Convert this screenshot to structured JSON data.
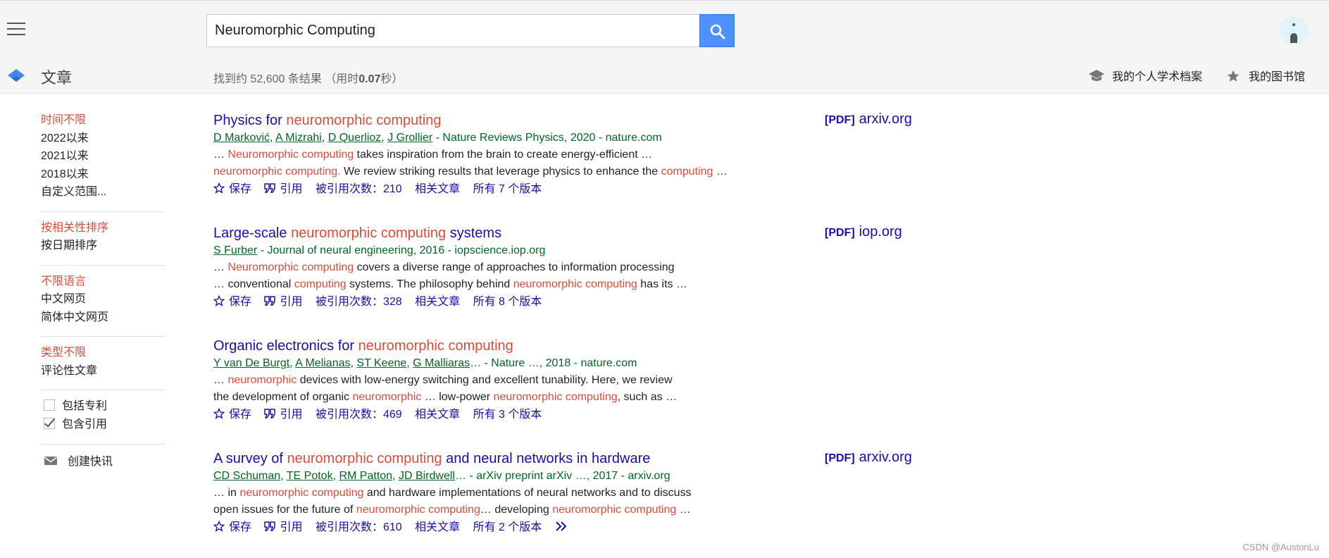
{
  "search": {
    "query": "Neuromorphic Computing"
  },
  "subbar": {
    "section_title": "文章",
    "stats_prefix": "找到约 52,600 条结果 （用时",
    "stats_time": "0.07",
    "stats_suffix": "秒）",
    "profile_label": "我的个人学术档案",
    "library_label": "我的图书馆"
  },
  "sidebar": {
    "time": [
      "时间不限",
      "2022以来",
      "2021以来",
      "2018以来",
      "自定义范围..."
    ],
    "sort": [
      "按相关性排序",
      "按日期排序"
    ],
    "language": [
      "不限语言",
      "中文网页",
      "简体中文网页"
    ],
    "type": [
      "类型不限",
      "评论性文章"
    ],
    "include_patents": "包括专利",
    "include_citations": "包含引用",
    "create_alert": "创建快讯"
  },
  "actions": {
    "save": "保存",
    "cite": "引用",
    "related": "相关文章"
  },
  "results": [
    {
      "title_pre": "Physics for ",
      "title_hl": "neuromorphic computing",
      "title_post": "",
      "authors": [
        "D Marković",
        "A Mizrahi",
        "D Querlioz",
        "J Grollier"
      ],
      "source": " - Nature Reviews Physics, 2020 - nature.com",
      "s1_a": "… ",
      "s1_b": "Neuromorphic computing",
      "s1_c": " takes inspiration from the brain to create energy-efficient …",
      "s2_a": "neuromorphic computing.",
      "s2_b": " We review striking results that leverage physics to enhance the ",
      "s2_c": "computing",
      "s2_d": " …",
      "cited": "被引用次数：210",
      "versions": "所有 7 个版本",
      "pdf_tag": "[PDF]",
      "pdf_site": "arxiv.org"
    },
    {
      "title_pre": "Large-scale ",
      "title_hl": "neuromorphic computing",
      "title_post": " systems",
      "authors": [
        "S Furber"
      ],
      "source": " - Journal of neural engineering, 2016 - iopscience.iop.org",
      "s1_a": "… ",
      "s1_b": "Neuromorphic computing",
      "s1_c": " covers a diverse range of approaches to information processing",
      "s2_a": "… conventional ",
      "s2_b": "computing",
      "s2_c": " systems. The philosophy behind ",
      "s2_d": "neuromorphic computing",
      "s2_e": " has its …",
      "cited": "被引用次数：328",
      "versions": "所有 8 个版本",
      "pdf_tag": "[PDF]",
      "pdf_site": "iop.org"
    },
    {
      "title_pre": "Organic electronics for ",
      "title_hl": "neuromorphic computing",
      "title_post": "",
      "authors": [
        "Y van De Burgt",
        "A Melianas",
        "ST Keene",
        "G Malliaras"
      ],
      "source": "… - Nature …, 2018 - nature.com",
      "s1_a": "… ",
      "s1_b": "neuromorphic",
      "s1_c": " devices with low-energy switching and excellent tunability. Here, we review",
      "s2_a": "the development of organic ",
      "s2_b": "neuromorphic",
      "s2_c": " … low-power ",
      "s2_d": "neuromorphic computing",
      "s2_e": ", such as …",
      "cited": "被引用次数：469",
      "versions": "所有 3 个版本"
    },
    {
      "title_pre": "A survey of ",
      "title_hl": "neuromorphic computing",
      "title_post": " and neural networks in hardware",
      "authors": [
        "CD Schuman",
        "TE Potok",
        "RM Patton",
        "JD Birdwell"
      ],
      "source": "… - arXiv preprint arXiv …, 2017 - arxiv.org",
      "s1_a": "… in ",
      "s1_b": "neuromorphic computing",
      "s1_c": " and hardware implementations of neural networks and to discuss",
      "s2_a": "open issues for the future of ",
      "s2_b": "neuromorphic computing",
      "s2_c": "… developing ",
      "s2_d": "neuromorphic computing",
      "s2_e": " …",
      "cited": "被引用次数：610",
      "versions": "所有 2 个版本",
      "pdf_tag": "[PDF]",
      "pdf_site": "arxiv.org"
    }
  ],
  "watermark": "CSDN @AustonLu",
  "colors": {
    "link": "#1a0dab",
    "highlight": "#dd4b39",
    "author": "#006621",
    "search_button": "#4d90fe"
  }
}
